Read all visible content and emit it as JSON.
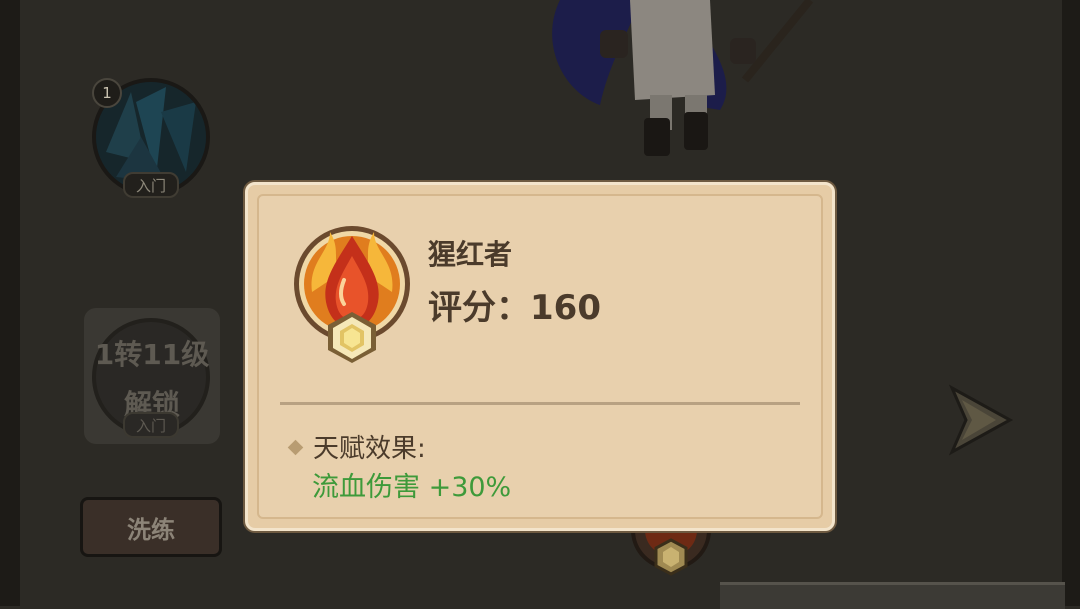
{
  "talent_slot": {
    "number": "1",
    "tag": "入门"
  },
  "locked_slot": {
    "line1": "1转11级",
    "line2": "解锁",
    "tag": "入门"
  },
  "refine_button": {
    "label": "洗练"
  },
  "popup": {
    "name": "猩红者",
    "score_label": "评分：",
    "score_value": "160",
    "effect_label": "天赋效果:",
    "effect_value": "流血伤害 +30%"
  },
  "colors": {
    "popup_bg": "#e8d0ad",
    "text_brown": "#4b3b2b",
    "effect_green": "#3e9a3a"
  },
  "icons": {
    "talent": "flame-drop-icon",
    "gem": "hexagon-gem-icon",
    "next": "right-arrow-icon"
  }
}
